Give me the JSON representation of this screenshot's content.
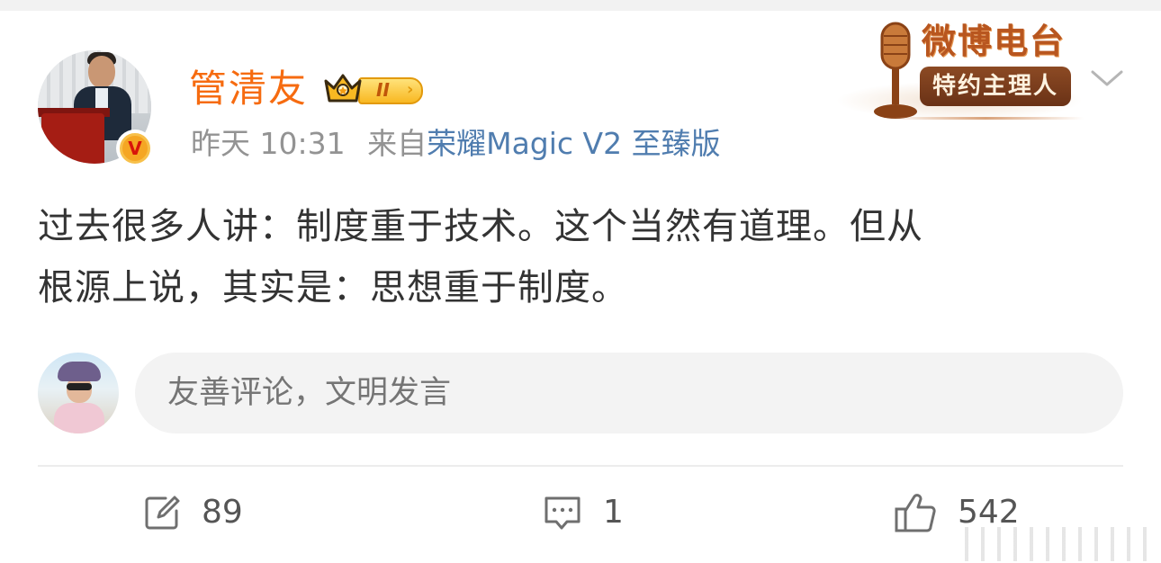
{
  "post": {
    "author": {
      "name": "管清友",
      "verified_icon": "V",
      "member_level": "II",
      "member_icon": "crown-icon"
    },
    "meta": {
      "time": "昨天 10:31",
      "source_prefix": "来自",
      "source": "荣耀Magic V2 至臻版"
    },
    "radio_badge": {
      "title": "微博电台",
      "subtitle": "特约主理人"
    },
    "content_lines": [
      "过去很多人讲：制度重于技术。这个当然有道理。但从",
      "根源上说，其实是：思想重于制度。"
    ],
    "comment": {
      "placeholder": "友善评论，文明发言"
    },
    "actions": {
      "repost_count": "89",
      "comment_count": "1",
      "like_count": "542"
    },
    "colors": {
      "username": "#f66b10",
      "source_link": "#507daf",
      "meta_gray": "#939393"
    }
  }
}
